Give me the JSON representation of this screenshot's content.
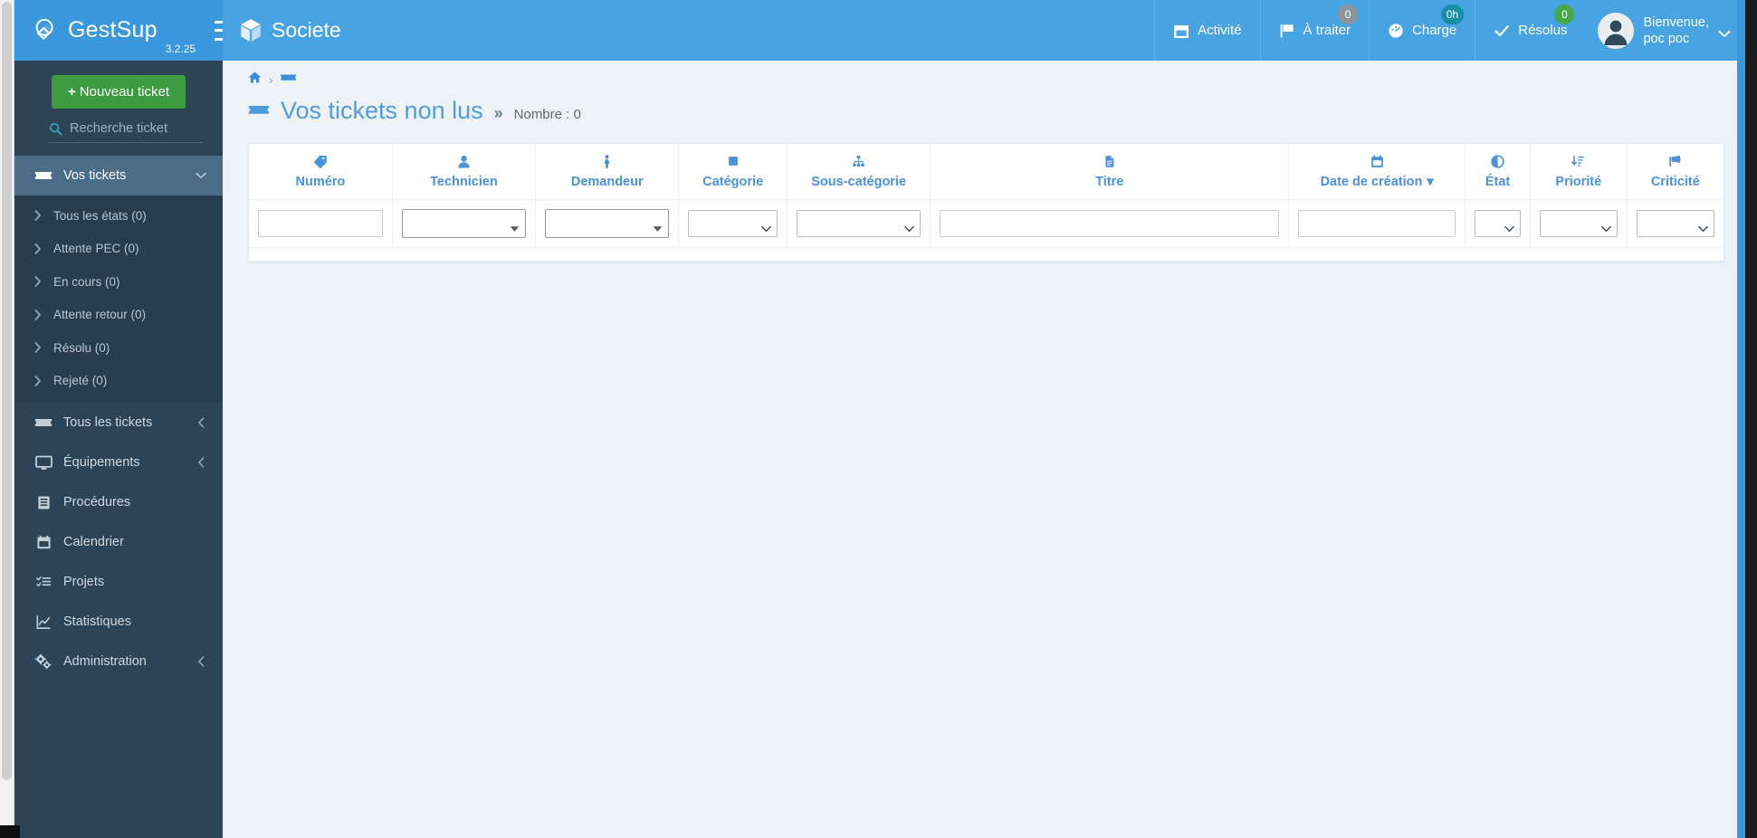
{
  "brand": {
    "name": "GestSup",
    "version": "3.2.25",
    "logo_icon": "gestsup-logo-icon",
    "menu_toggle_icon": "hamburger-icon"
  },
  "header": {
    "site_icon": "cube-icon",
    "site_name": "Societe",
    "items": [
      {
        "label": "Activité",
        "icon": "calendar-icon",
        "badge": null,
        "badge_color": null
      },
      {
        "label": "À traiter",
        "icon": "flag-icon",
        "badge": "0",
        "badge_color": "#8d9398"
      },
      {
        "label": "Charge",
        "icon": "gauge-icon",
        "badge": "0h",
        "badge_color": "#1b8ea6"
      },
      {
        "label": "Résolus",
        "icon": "check-icon",
        "badge": "0",
        "badge_color": "#45a948"
      }
    ],
    "user": {
      "greeting": "Bienvenue,",
      "name": "poc poc",
      "avatar_icon": "avatar-icon",
      "caret_icon": "chevron-down-icon"
    }
  },
  "sidebar": {
    "new_ticket_label": "Nouveau ticket",
    "search_placeholder": "Recherche ticket",
    "search_value": "",
    "search_icon": "search-icon",
    "groups": [
      {
        "label": "Vos tickets",
        "icon": "ticket-icon",
        "arrow": "chevron-down-icon",
        "active": true,
        "children": [
          {
            "label": "Tous les états (0)",
            "icon": "chevron-right-icon"
          },
          {
            "label": "Attente PEC (0)",
            "icon": "chevron-right-icon"
          },
          {
            "label": "En cours (0)",
            "icon": "chevron-right-icon"
          },
          {
            "label": "Attente retour (0)",
            "icon": "chevron-right-icon"
          },
          {
            "label": "Résolu (0)",
            "icon": "chevron-right-icon"
          },
          {
            "label": "Rejeté (0)",
            "icon": "chevron-right-icon"
          }
        ]
      }
    ],
    "items": [
      {
        "label": "Tous les tickets",
        "icon": "ticket-icon",
        "arrow": "chevron-left-icon"
      },
      {
        "label": "Équipements",
        "icon": "monitor-icon",
        "arrow": "chevron-left-icon"
      },
      {
        "label": "Procédures",
        "icon": "book-icon",
        "arrow": null
      },
      {
        "label": "Calendrier",
        "icon": "calendar-icon",
        "arrow": null
      },
      {
        "label": "Projets",
        "icon": "tasklist-icon",
        "arrow": null
      },
      {
        "label": "Statistiques",
        "icon": "chart-line-icon",
        "arrow": null
      },
      {
        "label": "Administration",
        "icon": "gears-icon",
        "arrow": "chevron-left-icon"
      }
    ]
  },
  "breadcrumb": {
    "home_icon": "home-icon",
    "separator": "›",
    "current_icon": "ticket-icon"
  },
  "page": {
    "icon": "ticket-icon",
    "title": "Vos tickets non lus",
    "chevron": "»",
    "count_label": "Nombre : 0"
  },
  "table": {
    "columns": [
      {
        "key": "numero",
        "label": "Numéro",
        "icon": "tag-icon",
        "filter": "text",
        "value": "",
        "sorted": false
      },
      {
        "key": "technicien",
        "label": "Technicien",
        "icon": "user-icon",
        "filter": "select2",
        "value": "",
        "sorted": false
      },
      {
        "key": "demandeur",
        "label": "Demandeur",
        "icon": "person-icon",
        "filter": "select2",
        "value": "",
        "sorted": false
      },
      {
        "key": "categorie",
        "label": "Catégorie",
        "icon": "square-icon",
        "filter": "select",
        "value": "",
        "sorted": false
      },
      {
        "key": "sous_categorie",
        "label": "Sous-catégorie",
        "icon": "sitemap-icon",
        "filter": "select",
        "value": "",
        "sorted": false
      },
      {
        "key": "titre",
        "label": "Titre",
        "icon": "document-icon",
        "filter": "text",
        "value": "",
        "sorted": false
      },
      {
        "key": "date_creation",
        "label": "Date de création",
        "icon": "calendar-icon",
        "filter": "text",
        "value": "",
        "sorted": true,
        "sort_caret": "▾"
      },
      {
        "key": "etat",
        "label": "État",
        "icon": "contrast-icon",
        "filter": "select",
        "value": "",
        "sorted": false
      },
      {
        "key": "priorite",
        "label": "Priorité",
        "icon": "sort-amount-icon",
        "filter": "select",
        "value": "",
        "sorted": false
      },
      {
        "key": "criticite",
        "label": "Criticité",
        "icon": "megaphone-icon",
        "filter": "select",
        "value": "",
        "sorted": false
      }
    ],
    "rows": [],
    "empty": true
  },
  "colors": {
    "brand_blue": "#3c98dc",
    "navbar_blue": "#48a3e3",
    "sidebar_dark": "#2c4456",
    "sidebar_submenu": "#283e4e",
    "sidebar_active": "#4b6d88",
    "content_bg": "#edf2f7",
    "link_blue": "#4a92dd",
    "green_button": "#3d9c42"
  }
}
